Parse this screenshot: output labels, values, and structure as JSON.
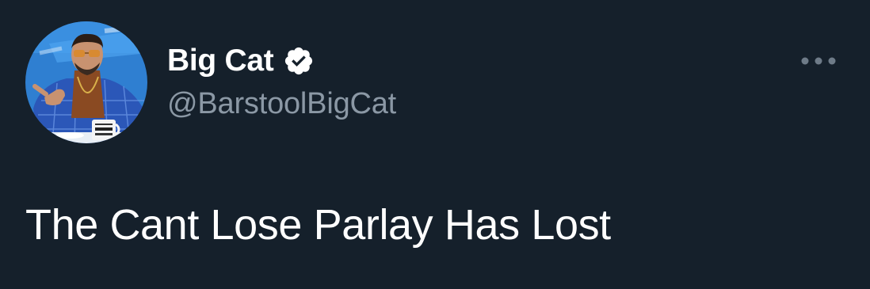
{
  "author": {
    "display_name": "Big Cat",
    "handle": "@BarstoolBigCat",
    "verified": true,
    "avatar_mug_text": "KILL YOUR BOOK MAKER"
  },
  "tweet": {
    "text": "The Cant Lose Parlay Has Lost"
  },
  "icons": {
    "verified": "verified-badge-icon",
    "more": "more-options-icon"
  },
  "colors": {
    "background": "#15202b",
    "primary_text": "#ffffff",
    "secondary_text": "#8b98a5",
    "avatar_backdrop": "#2f7fd1",
    "suit": "#2b57b8"
  }
}
